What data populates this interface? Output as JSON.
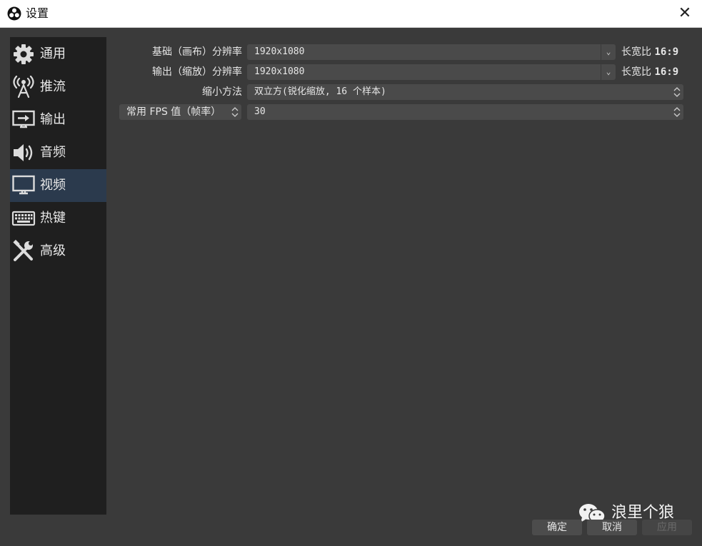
{
  "window": {
    "title": "设置",
    "close_glyph": "✕",
    "logo_icon": "obs-logo-icon"
  },
  "sidebar": {
    "items": [
      {
        "label": "通用",
        "icon": "gear-icon",
        "active": false
      },
      {
        "label": "推流",
        "icon": "broadcast-antenna-icon",
        "active": false
      },
      {
        "label": "输出",
        "icon": "output-monitor-icon",
        "active": false
      },
      {
        "label": "音频",
        "icon": "speaker-icon",
        "active": false
      },
      {
        "label": "视频",
        "icon": "monitor-icon",
        "active": true
      },
      {
        "label": "热键",
        "icon": "keyboard-icon",
        "active": false
      },
      {
        "label": "高级",
        "icon": "tools-icon",
        "active": false
      }
    ]
  },
  "video": {
    "base_label": "基础（画布）分辨率",
    "base_value": "1920x1080",
    "base_aspect_label": "长宽比",
    "base_aspect_value": "16:9",
    "output_label": "输出（缩放）分辨率",
    "output_value": "1920x1080",
    "output_aspect_label": "长宽比",
    "output_aspect_value": "16:9",
    "downscale_label": "缩小方法",
    "downscale_value": "双立方(锐化缩放, 16 个样本)",
    "fps_type": "常用 FPS 值（帧率）",
    "fps_value": "30"
  },
  "buttons": {
    "ok": "确定",
    "cancel": "取消",
    "apply": "应用"
  },
  "watermark": {
    "text": "浪里个狼",
    "icon": "wechat-icon"
  },
  "colors": {
    "background": "#3a3a3a",
    "sidebar": "#1f1f1f",
    "active_item": "#2b3a4d",
    "field": "#4a4a4a"
  }
}
